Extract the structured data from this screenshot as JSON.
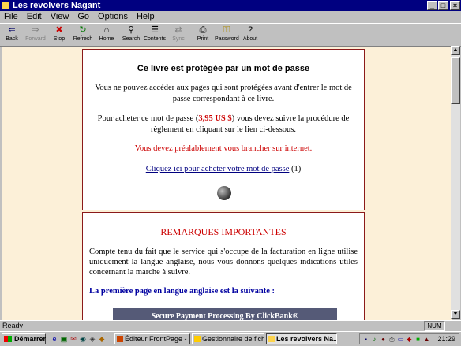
{
  "window": {
    "title": "Les revolvers Nagant",
    "controls": [
      "_",
      "□",
      "×"
    ]
  },
  "menu": [
    "File",
    "Edit",
    "View",
    "Go",
    "Options",
    "Help"
  ],
  "toolbar": [
    {
      "label": "Back",
      "icon": "back-arrow-icon",
      "glyph": "⇐",
      "disabled": false
    },
    {
      "label": "Forward",
      "icon": "forward-arrow-icon",
      "glyph": "⇒",
      "disabled": true
    },
    {
      "label": "Stop",
      "icon": "stop-icon",
      "glyph": "✖",
      "disabled": false
    },
    {
      "label": "Refresh",
      "icon": "refresh-icon",
      "glyph": "↻",
      "disabled": false
    },
    {
      "label": "Home",
      "icon": "home-icon",
      "glyph": "⌂",
      "disabled": false
    },
    {
      "label": "Search",
      "icon": "search-icon",
      "glyph": "⚲",
      "disabled": false
    },
    {
      "label": "Contents",
      "icon": "contents-icon",
      "glyph": "☰",
      "disabled": false
    },
    {
      "label": "Sync",
      "icon": "sync-icon",
      "glyph": "⇄",
      "disabled": true
    },
    {
      "label": "Print",
      "icon": "print-icon",
      "glyph": "⎙",
      "disabled": false
    },
    {
      "label": "Password",
      "icon": "key-icon",
      "glyph": "⚿",
      "disabled": false
    },
    {
      "label": "About",
      "icon": "about-icon",
      "glyph": "?",
      "disabled": false
    }
  ],
  "page": {
    "box1": {
      "title": "Ce livre est protégée par un mot de passe",
      "p1": "Vous ne pouvez accéder aux pages qui sont protégées avant d'entrer le mot de passe correspondant à ce livre.",
      "p2_before": "Pour acheter ce mot de passe (",
      "price": "3,95 US $",
      "p2_after": ") vous devez suivre la procédure de règlement en cliquant sur le lien ci-dessous.",
      "warning": "Vous devez préalablement vous brancher sur internet.",
      "link": "Cliquez ici pour acheter votre mot de passe",
      "link_note": "(1)"
    },
    "box2": {
      "title": "REMARQUES IMPORTANTES",
      "p1": "Compte tenu du fait que le service qui s'occupe de la facturation en ligne utilise uniquement la langue anglaise, nous vous donnons quelques indications utiles concernant la marche à suivre.",
      "p2": "La première page en langue anglaise est la suivante :",
      "banner": "Secure Payment Processing By ClickBank®"
    }
  },
  "status": {
    "text": "Ready",
    "num": "NUM"
  },
  "taskbar": {
    "start": "Démarrer",
    "tasks": [
      {
        "label": "Éditeur FrontPage - [..."
      },
      {
        "label": "Gestionnaire de fichi..."
      },
      {
        "label": "Les revolvers Na..."
      }
    ],
    "clock": "21:29"
  }
}
